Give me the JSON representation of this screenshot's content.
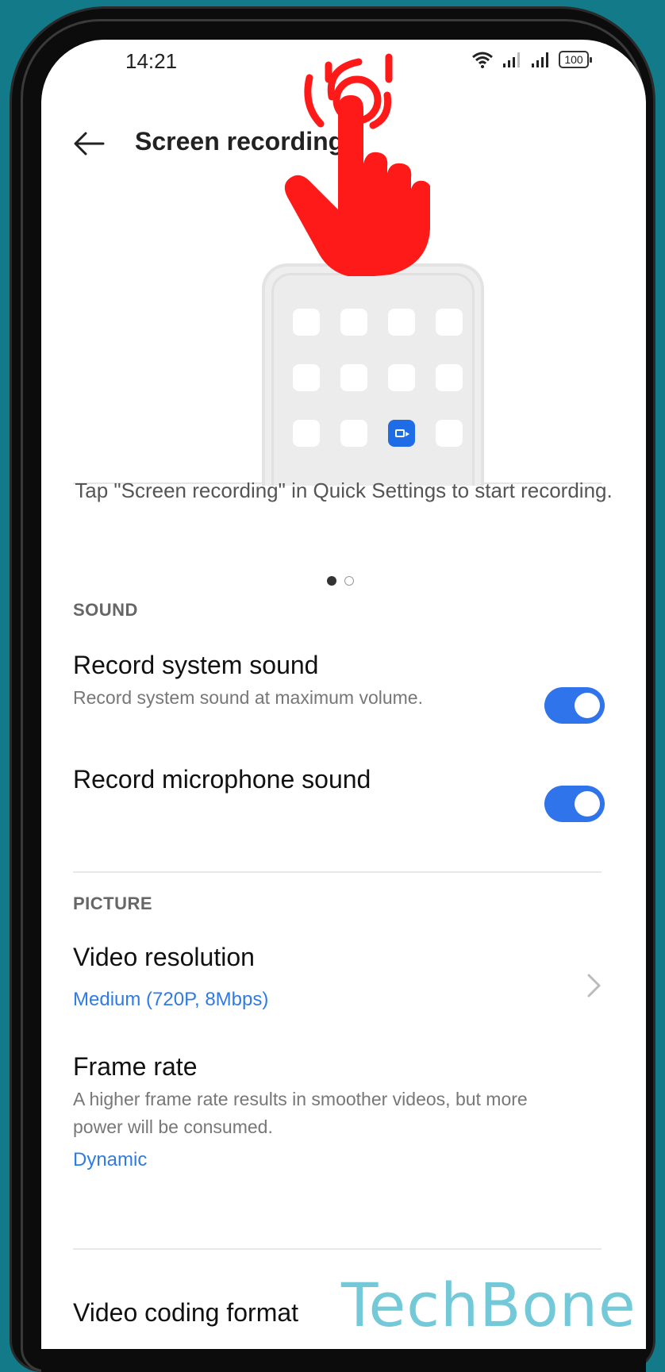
{
  "status_bar": {
    "time": "14:21",
    "battery": "100"
  },
  "header": {
    "title": "Screen recording"
  },
  "illustration": {
    "caption": "Tap \"Screen recording\" in Quick Settings to start recording.",
    "page_count": 2,
    "active_page": 1
  },
  "sound": {
    "label": "SOUND",
    "system_sound": {
      "title": "Record system sound",
      "subtitle": "Record system sound at maximum volume.",
      "enabled": true
    },
    "microphone_sound": {
      "title": "Record microphone sound",
      "enabled": true
    }
  },
  "picture": {
    "label": "PICTURE",
    "video_resolution": {
      "title": "Video resolution",
      "value": "Medium (720P, 8Mbps)"
    },
    "frame_rate": {
      "title": "Frame rate",
      "subtitle": "A higher frame rate results in smoother videos, but more power will be consumed.",
      "value": "Dynamic"
    },
    "video_coding_format": {
      "title": "Video coding format"
    }
  },
  "watermark": "TechBone",
  "colors": {
    "accent": "#2f74ea",
    "link": "#2f7be6",
    "background": "#127a88",
    "hand": "#ff1a1a"
  }
}
